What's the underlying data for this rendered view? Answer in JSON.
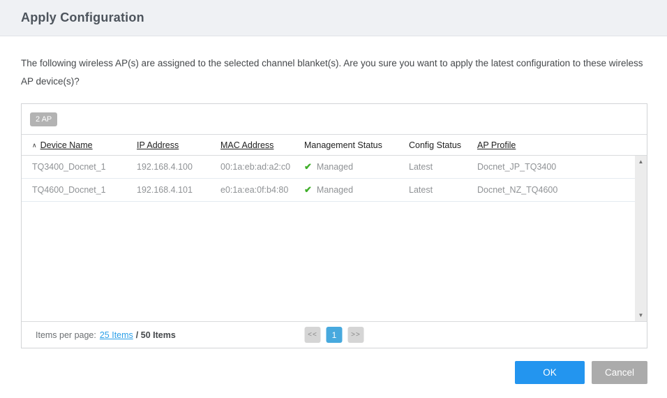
{
  "dialog": {
    "title": "Apply Configuration"
  },
  "message": "The following wireless AP(s) are assigned to the selected channel blanket(s). Are you sure you want to apply the latest configuration to these wireless AP device(s)?",
  "table": {
    "count_badge": "2 AP",
    "columns": [
      {
        "label": "Device Name",
        "sortable": true,
        "sorted": "ascending"
      },
      {
        "label": "IP Address",
        "sortable": true
      },
      {
        "label": "MAC Address",
        "sortable": true
      },
      {
        "label": "Management Status",
        "sortable": false
      },
      {
        "label": "Config Status",
        "sortable": false
      },
      {
        "label": "AP Profile",
        "sortable": true
      }
    ],
    "rows": [
      {
        "device_name": "TQ3400_Docnet_1",
        "ip_address": "192.168.4.100",
        "mac_address": "00:1a:eb:ad:a2:c0",
        "management_status": "Managed",
        "config_status": "Latest",
        "ap_profile": "Docnet_JP_TQ3400"
      },
      {
        "device_name": "TQ4600_Docnet_1",
        "ip_address": "192.168.4.101",
        "mac_address": "e0:1a:ea:0f:b4:80",
        "management_status": "Managed",
        "config_status": "Latest",
        "ap_profile": "Docnet_NZ_TQ4600"
      }
    ]
  },
  "pagination": {
    "items_per_page_label": "Items per page:",
    "items_per_page_link": "25 Items",
    "total_label": "/ 50 Items",
    "prev_label": "<<",
    "current_page": "1",
    "next_label": ">>"
  },
  "footer": {
    "ok_label": "OK",
    "cancel_label": "Cancel"
  },
  "icons": {
    "sort_asc": "∧",
    "managed_check": "✔",
    "scroll_up": "▲",
    "scroll_down": "▼"
  },
  "colors": {
    "accent_blue": "#2395ef",
    "link_blue": "#2b9fe8",
    "pager_active_blue": "#47a9de",
    "managed_green": "#3fae29",
    "badge_gray": "#b3b3b3",
    "cancel_gray": "#ababab",
    "header_bg": "#eff1f4"
  }
}
